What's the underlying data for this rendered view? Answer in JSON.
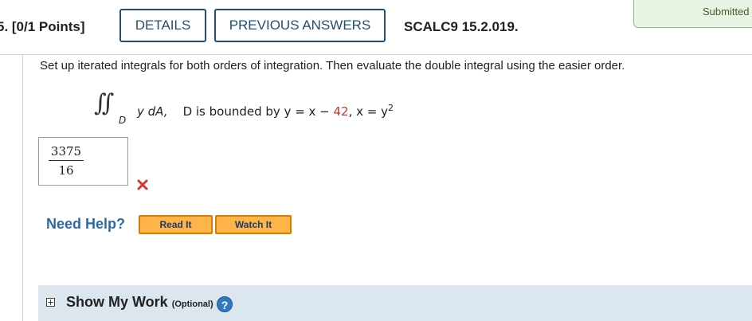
{
  "header": {
    "question_number": "5. [0/1 Points]",
    "details_label": "DETAILS",
    "previous_answers_label": "PREVIOUS ANSWERS",
    "reference": "SCALC9 15.2.019.",
    "submitted_label": "Submitted"
  },
  "question": {
    "prompt": "Set up iterated integrals for both orders of integration. Then evaluate the double integral using the easier order.",
    "integral_symbol": "∫∫",
    "integral_subscript": "D",
    "integrand": "y dA,",
    "region_prefix": "D is bounded by y = x − ",
    "region_value": "42",
    "region_suffix": ", x = y",
    "region_exponent": "2"
  },
  "answer": {
    "numerator": "3375",
    "denominator": "16",
    "status": "incorrect"
  },
  "help": {
    "need_help_label": "Need Help?",
    "read_it_label": "Read It",
    "watch_it_label": "Watch It"
  },
  "show_my_work": {
    "label": "Show My Work",
    "optional_label": "(Optional)",
    "help_icon_text": "?",
    "expand_icon_text": "+"
  },
  "colors": {
    "accent": "#1f4e79",
    "error": "#d9342b",
    "help_link": "#2b6aa6",
    "orange_button": "#ffb449",
    "panel_background": "#dce6ee"
  }
}
